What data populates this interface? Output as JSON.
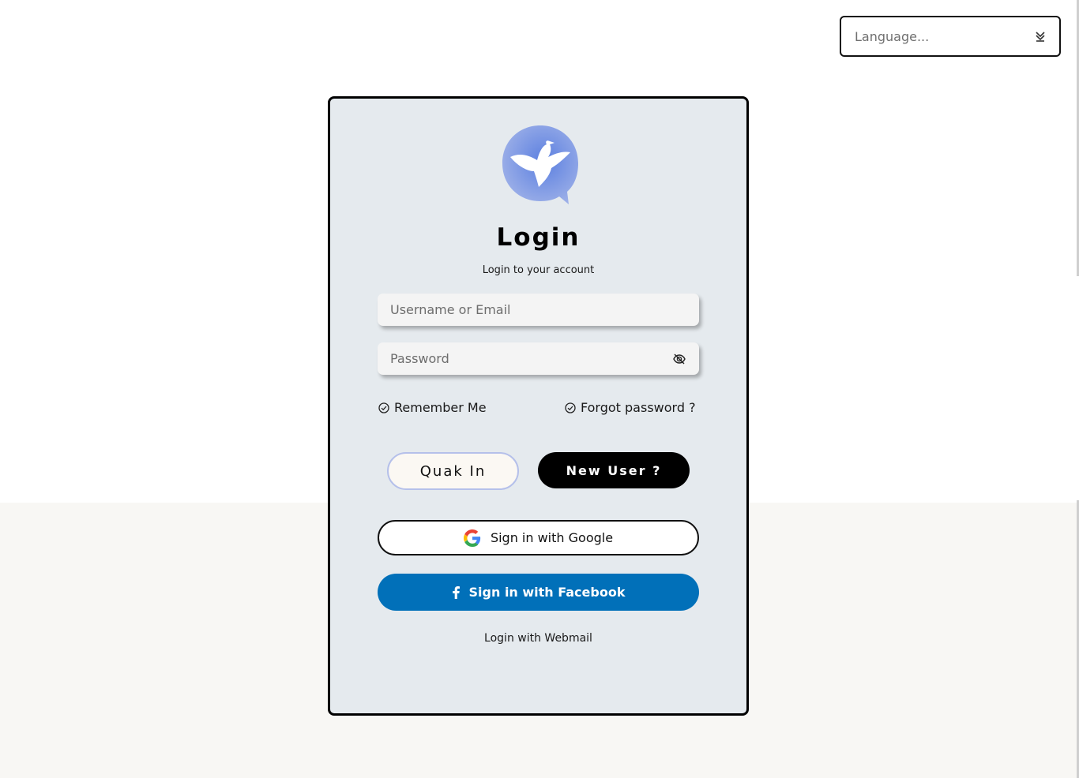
{
  "language": {
    "placeholder": "Language...",
    "icon": "chevron-double-down-icon"
  },
  "login": {
    "logo_icon": "duck-chat-bubble-logo",
    "title": "Login",
    "subtitle": "Login to your account",
    "username_placeholder": "Username or Email",
    "password_placeholder": "Password",
    "password_toggle_icon": "eye-off-icon",
    "remember_label": "Remember Me",
    "forgot_label": "Forgot password ?",
    "quak_label": "Quak In",
    "new_user_label": "New User ?",
    "google_label": "Sign in with Google",
    "facebook_label": "Sign in with Facebook",
    "webmail_label": "Login with Webmail"
  },
  "colors": {
    "card_bg": "#e5eaee",
    "facebook_blue": "#0170b9",
    "logo_blue": "#7f98df",
    "quak_border": "#b5c0ea"
  }
}
